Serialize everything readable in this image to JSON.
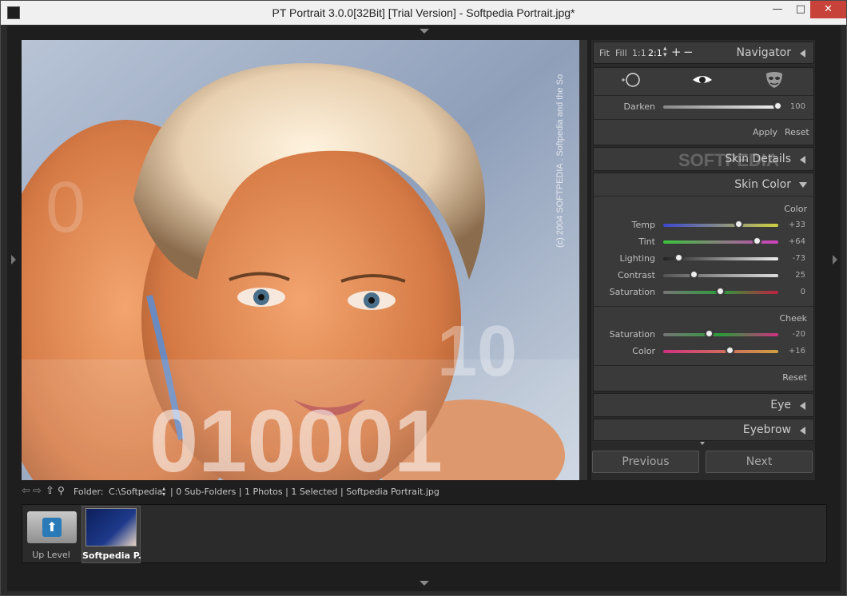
{
  "window": {
    "title": "PT Portrait 3.0.0[32Bit] [Trial Version] - Softpedia Portrait.jpg*",
    "minimize": "—",
    "maximize": "□",
    "close": "✕"
  },
  "photo": {
    "caption": "(c) 2004 SOFTPEDIA . Softpedia and the So"
  },
  "navigator": {
    "zoom_fit": "Fit",
    "zoom_fill": "Fill",
    "zoom_1_1": "1:1",
    "zoom_custom": "2:1",
    "zoom_in": "+",
    "zoom_out": "−",
    "title": "Navigator"
  },
  "tools": {
    "darken_label": "Darken",
    "darken_value": "100",
    "darken_fraction": 1.0,
    "apply": "Apply",
    "reset": "Reset"
  },
  "watermark": "SOFTPEDIA",
  "skin_details": {
    "title": "Skin Details"
  },
  "skin_color": {
    "title": "Skin Color",
    "group_color": "Color",
    "group_cheek": "Cheek",
    "reset": "Reset",
    "color_sliders": [
      {
        "label": "Temp",
        "value": "+33",
        "pos": 0.66
      },
      {
        "label": "Tint",
        "value": "+64",
        "pos": 0.82
      },
      {
        "label": "Lighting",
        "value": "-73",
        "pos": 0.14
      },
      {
        "label": "Contrast",
        "value": "25",
        "pos": 0.27
      },
      {
        "label": "Saturation",
        "value": "0",
        "pos": 0.5
      }
    ],
    "cheek_sliders": [
      {
        "label": "Saturation",
        "value": "-20",
        "pos": 0.4
      },
      {
        "label": "Color",
        "value": "+16",
        "pos": 0.58
      }
    ]
  },
  "eye": {
    "title": "Eye"
  },
  "eyebrow": {
    "title": "Eyebrow"
  },
  "nav_buttons": {
    "previous": "Previous",
    "next": "Next"
  },
  "browser": {
    "folder_label": "Folder:",
    "folder_value": "C:\\Softpedia",
    "info": "| 0 Sub-Folders | 1 Photos | 1 Selected | Softpedia Portrait.jpg"
  },
  "filmstrip": {
    "up_level": "Up Level",
    "thumb_label": "Softpedia P..."
  }
}
